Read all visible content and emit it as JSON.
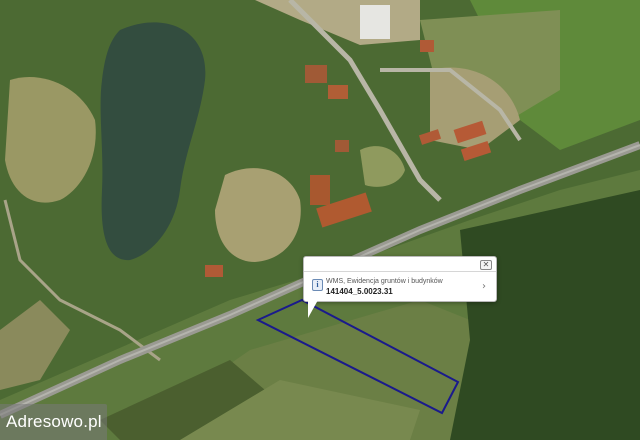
{
  "map": {
    "parcel_outline_color": "#1a1a8c",
    "road_color": "#9a9a92"
  },
  "popup": {
    "layer_name": "WMS, Ewidencja gruntów i budynków",
    "parcel_id": "141404_5.0023.31",
    "close_icon": "close-icon",
    "info_icon": "info-icon",
    "info_glyph": "i",
    "more_icon": "chevron-right-icon"
  },
  "watermark": {
    "text": "Adresowo.pl"
  }
}
